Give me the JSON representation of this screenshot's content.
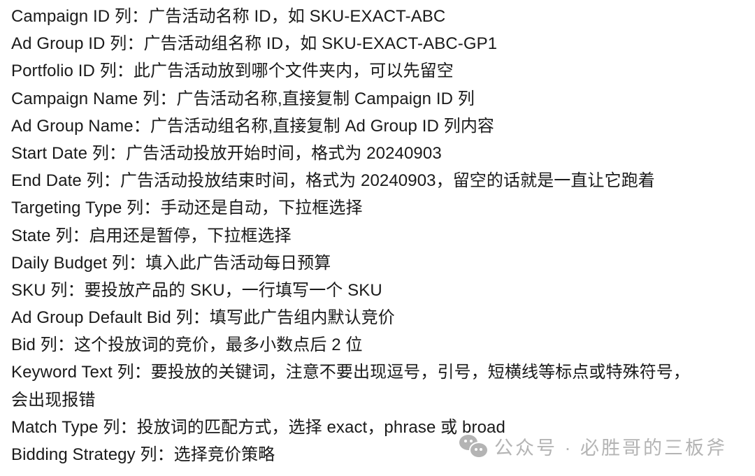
{
  "lines": [
    {
      "field": "Campaign ID",
      "text": " 列：广告活动名称 ID，如 SKU-EXACT-ABC"
    },
    {
      "field": "Ad Group ID",
      "text": " 列：广告活动组名称 ID，如 SKU-EXACT-ABC-GP1"
    },
    {
      "field": "Portfolio ID",
      "text": " 列：此广告活动放到哪个文件夹内，可以先留空"
    },
    {
      "field": "Campaign Name",
      "text": " 列：广告活动名称,直接复制 Campaign ID 列"
    },
    {
      "field": "Ad Group Name",
      "text": "：广告活动组名称,直接复制 Ad Group ID 列内容"
    },
    {
      "field": "Start Date",
      "text": " 列：广告活动投放开始时间，格式为 20240903"
    },
    {
      "field": "End Date",
      "text": " 列：广告活动投放结束时间，格式为 20240903，留空的话就是一直让它跑着"
    },
    {
      "field": "Targeting Type",
      "text": " 列：手动还是自动，下拉框选择"
    },
    {
      "field": "State",
      "text": " 列：启用还是暂停，下拉框选择"
    },
    {
      "field": "Daily Budget",
      "text": " 列：填入此广告活动每日预算"
    },
    {
      "field": "SKU",
      "text": " 列：要投放产品的 SKU，一行填写一个 SKU"
    },
    {
      "field": "Ad Group Default Bid",
      "text": " 列：填写此广告组内默认竞价"
    },
    {
      "field": "Bid",
      "text": " 列：这个投放词的竞价，最多小数点后 2 位"
    },
    {
      "field": "Keyword Text",
      "text": " 列：要投放的关键词，注意不要出现逗号，引号，短横线等标点或特殊符号，"
    },
    {
      "field": "",
      "text": "会出现报错"
    },
    {
      "field": "Match Type",
      "text": " 列：投放词的匹配方式，选择 exact，phrase 或 broad"
    },
    {
      "field": "Bidding Strategy",
      "text": " 列：选择竞价策略"
    }
  ],
  "watermark": {
    "icon": "wechat-icon",
    "text": "公众号 · 必胜哥的三板斧"
  }
}
